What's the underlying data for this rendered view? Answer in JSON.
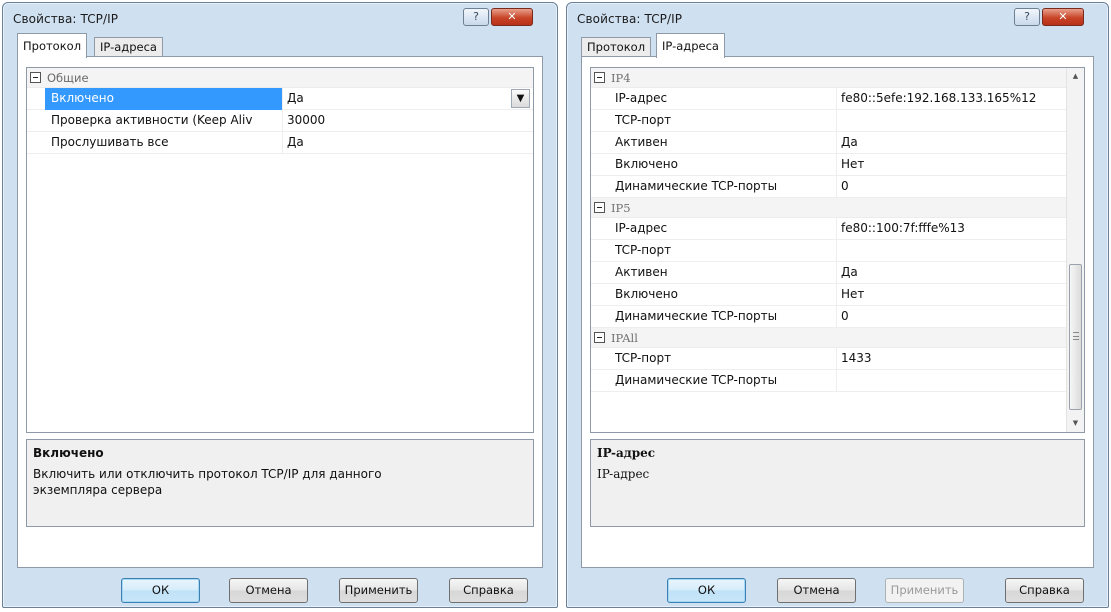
{
  "left_dialog": {
    "title": "Свойства: TCP/IP",
    "help_symbol": "?",
    "close_symbol": "✕",
    "tabs": [
      "Протокол",
      "IP-адреса"
    ],
    "active_tab": "Протокол",
    "category": "Общие",
    "rows": [
      {
        "name": "Включено",
        "value": "Да",
        "selected": true
      },
      {
        "name": "Проверка активности (Keep Aliv",
        "value": "30000"
      },
      {
        "name": "Прослушивать все",
        "value": "Да"
      }
    ],
    "dropdown_symbol": "▼",
    "description": {
      "title": "Включено",
      "text": "Включить или отключить протокол TCP/IP для данного экземпляра сервера"
    },
    "buttons": {
      "ok": "ОК",
      "cancel": "Отмена",
      "apply": "Применить",
      "help": "Справка"
    }
  },
  "right_dialog": {
    "title": "Свойства: TCP/IP",
    "help_symbol": "?",
    "close_symbol": "✕",
    "tabs": [
      "Протокол",
      "IP-адреса"
    ],
    "active_tab": "IP-адреса",
    "groups": [
      {
        "name": "IP4",
        "rows": [
          {
            "name": "IP-адрес",
            "value": "fe80::5efe:192.168.133.165%12"
          },
          {
            "name": "TCP-порт",
            "value": ""
          },
          {
            "name": "Активен",
            "value": "Да"
          },
          {
            "name": "Включено",
            "value": "Нет"
          },
          {
            "name": "Динамические TCP-порты",
            "value": "0"
          }
        ]
      },
      {
        "name": "IP5",
        "rows": [
          {
            "name": "IP-адрес",
            "value": "fe80::100:7f:fffe%13"
          },
          {
            "name": "TCP-порт",
            "value": ""
          },
          {
            "name": "Активен",
            "value": "Да"
          },
          {
            "name": "Включено",
            "value": "Нет"
          },
          {
            "name": "Динамические TCP-порты",
            "value": "0"
          }
        ]
      },
      {
        "name": "IPAll",
        "rows": [
          {
            "name": "TCP-порт",
            "value": "1433"
          },
          {
            "name": "Динамические TCP-порты",
            "value": ""
          }
        ]
      }
    ],
    "description": {
      "title": "IP-адрес",
      "text": "IP-адрес"
    },
    "buttons": {
      "ok": "ОК",
      "cancel": "Отмена",
      "apply": "Применить",
      "help": "Справка"
    },
    "apply_disabled": true
  },
  "colors": {
    "selection": "#3399ff",
    "window_frame": "#cfe0f1",
    "close_button": "#c84528"
  },
  "icons": {
    "collapse": "minus-box-icon",
    "scroll_up": "arrow-up-icon",
    "scroll_down": "arrow-down-icon"
  }
}
